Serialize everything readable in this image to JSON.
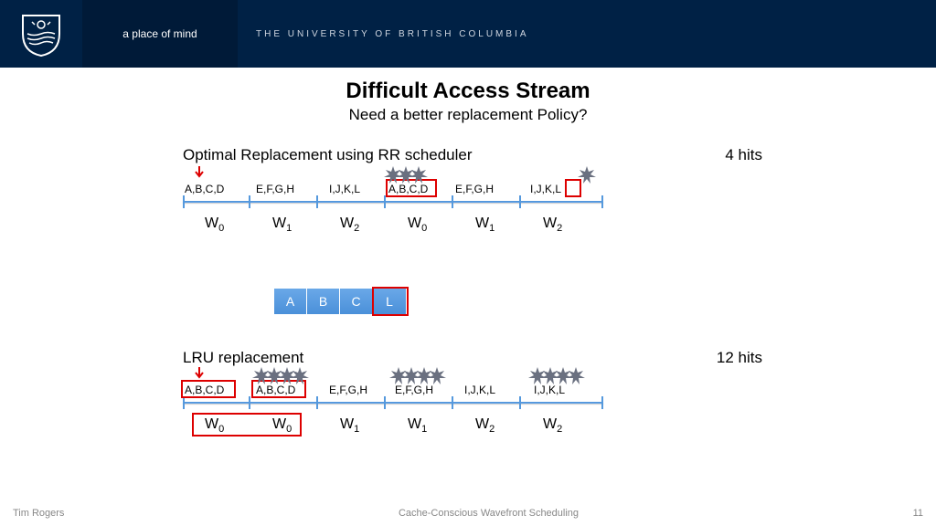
{
  "header": {
    "tagline": "a place of mind",
    "university": "THE UNIVERSITY OF BRITISH COLUMBIA"
  },
  "title": "Difficult Access Stream",
  "subtitle": "Need a better replacement Policy?",
  "section1": {
    "label": "Optimal Replacement using RR scheduler",
    "hits": "4 hits",
    "acc": [
      "A,B,C,D",
      "E,F,G,H",
      "I,J,K,L",
      "A,B,C,D",
      "E,F,G,H",
      "I,J,K,L"
    ],
    "w": [
      "W",
      "W",
      "W",
      "W",
      "W",
      "W"
    ],
    "wsub": [
      "0",
      "1",
      "2",
      "0",
      "1",
      "2"
    ]
  },
  "cache": {
    "cells": [
      "A",
      "B",
      "C",
      "L"
    ]
  },
  "section2": {
    "label": "LRU replacement",
    "hits": "12 hits",
    "acc": [
      "A,B,C,D",
      "A,B,C,D",
      "E,F,G,H",
      "E,F,G,H",
      "I,J,K,L",
      "I,J,K,L"
    ],
    "w": [
      "W",
      "W",
      "W",
      "W",
      "W",
      "W"
    ],
    "wsub": [
      "0",
      "0",
      "1",
      "1",
      "2",
      "2"
    ]
  },
  "footer": {
    "left": "Tim Rogers",
    "center": "Cache-Conscious Wavefront Scheduling",
    "right": "11"
  }
}
